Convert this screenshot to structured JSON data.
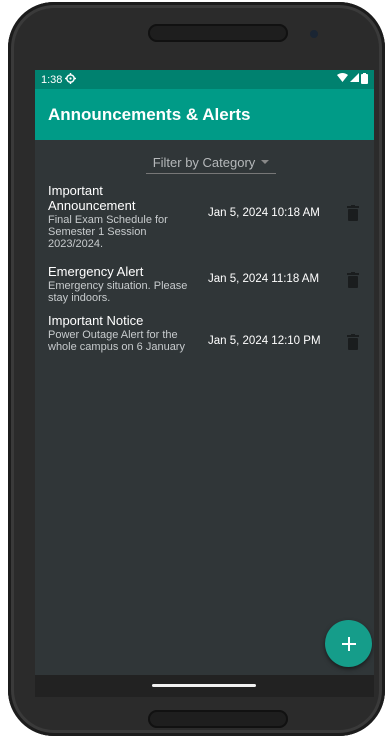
{
  "status": {
    "time": "1:38"
  },
  "appbar": {
    "title": "Announcements & Alerts"
  },
  "filter": {
    "label": "Filter by Category"
  },
  "announcements": [
    {
      "title": "Important Announcement",
      "body": "Final Exam Schedule for Semester 1 Session 2023/2024.",
      "date": "Jan 5, 2024 10:18 AM"
    },
    {
      "title": "Emergency Alert",
      "body": "Emergency situation. Please stay indoors.",
      "date": "Jan 5, 2024 11:18 AM"
    },
    {
      "title": "Important Notice",
      "body": "Power Outage Alert for the whole campus on 6 January",
      "date": "Jan 5, 2024 12:10 PM"
    }
  ],
  "fab": {
    "icon": "plus-icon"
  },
  "colors": {
    "statusbar": "#00816f",
    "appbar": "#009b87",
    "background": "#303638",
    "fab": "#159d8a"
  }
}
